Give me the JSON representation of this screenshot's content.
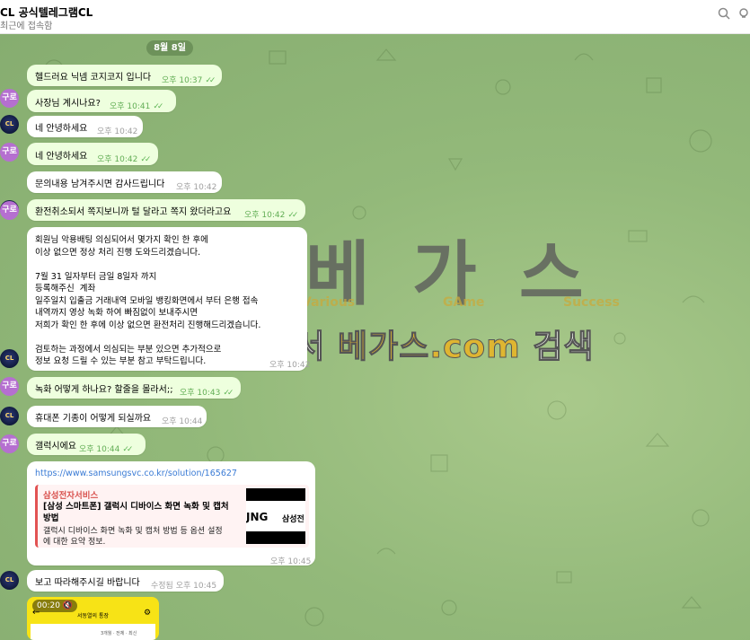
{
  "header": {
    "title": "CL 공식텔레그램CL",
    "subtitle": "최근에 접속함",
    "search_icon": "search-icon",
    "menu_icon": "more-icon"
  },
  "date_pill": "8월 8일",
  "avatars": {
    "user": "구로",
    "bot": "CL"
  },
  "messages": [
    {
      "text": "헬드러요 닉넴 코지코지 입니다",
      "time": "오후 10:37"
    },
    {
      "text": "사장님 계시나요?",
      "time": "오후 10:41"
    },
    {
      "text": "네 안녕하세요",
      "time": "오후 10:42"
    },
    {
      "text": "네 안녕하세요",
      "time": "오후 10:42"
    },
    {
      "text": "문의내용 남겨주시면 감사드립니다",
      "time": "오후 10:42"
    },
    {
      "text": "환전취소되서 쪽지보니까 털 달라고 쪽지 왔더라고요",
      "time": "오후 10:42"
    },
    {
      "text": "회원님 악용배팅 의심되어서 몇가지 확인 한 후에\n이상 없으면 정상 처리 진행 도와드리겠습니다.\n\n7월 31 일자부터 금일 8일자 까지\n등록해주신  계좌\n일주일치 입출금 거래내역 모바일 뱅킹화면에서 부터 은행 접속\n내역까지 영상 녹화 하여 빠짐없이 보내주시면\n저희가 확인 한 후에 이상 없으면 환전처리 진행해드리겠습니다.\n\n검토하는 과정에서 의심되는 부분 있으면 추가적으로\n정보 요청 드릴 수 있는 부분 참고 부탁드립니다.",
      "time": "오후 10:42"
    },
    {
      "text": "녹화 어떻게 하나요? 할줄을 몰라서;;",
      "time": "오후 10:43"
    },
    {
      "text": "휴대폰 기종이 어떻게 되실까요",
      "time": "오후 10:44"
    },
    {
      "text": "갤럭시에요",
      "time": "오후 10:44"
    },
    {
      "text": "보고 따라해주시길 바랍니다",
      "time": "수정됨 오후 10:45"
    }
  ],
  "link_message": {
    "url": "https://www.samsungsvc.co.kr/solution/165627",
    "site": "삼성전자서비스",
    "title": "[삼성 스마트폰] 갤럭시 디바이스 화면 녹화 및 캡처 방법",
    "description": "갤럭시 디바이스 화면 녹화 및 캡처 방법 등 옵션 설정에 대한 요약 정보.",
    "thumb_brand": "JNG",
    "thumb_brand2": "삼성전",
    "time": "오후 10:45"
  },
  "video": {
    "duration": "00:20",
    "mute_icon": "speaker-muted-icon",
    "screen_title": "서동열의 통장",
    "screen_small": "3개월 · 전체 · 최신"
  },
  "watermark": {
    "big": "베 가 스",
    "tags": [
      "Various",
      "GAme",
      "Success"
    ],
    "search_prefix": "구글에서",
    "search_brand": "베가스.com",
    "search_suffix": "검색"
  },
  "colors": {
    "outgoing": "#eeffde",
    "incoming": "#ffffff",
    "tick": "#5fb556",
    "link": "#3a7bd5",
    "preview_accent": "#e25353"
  }
}
